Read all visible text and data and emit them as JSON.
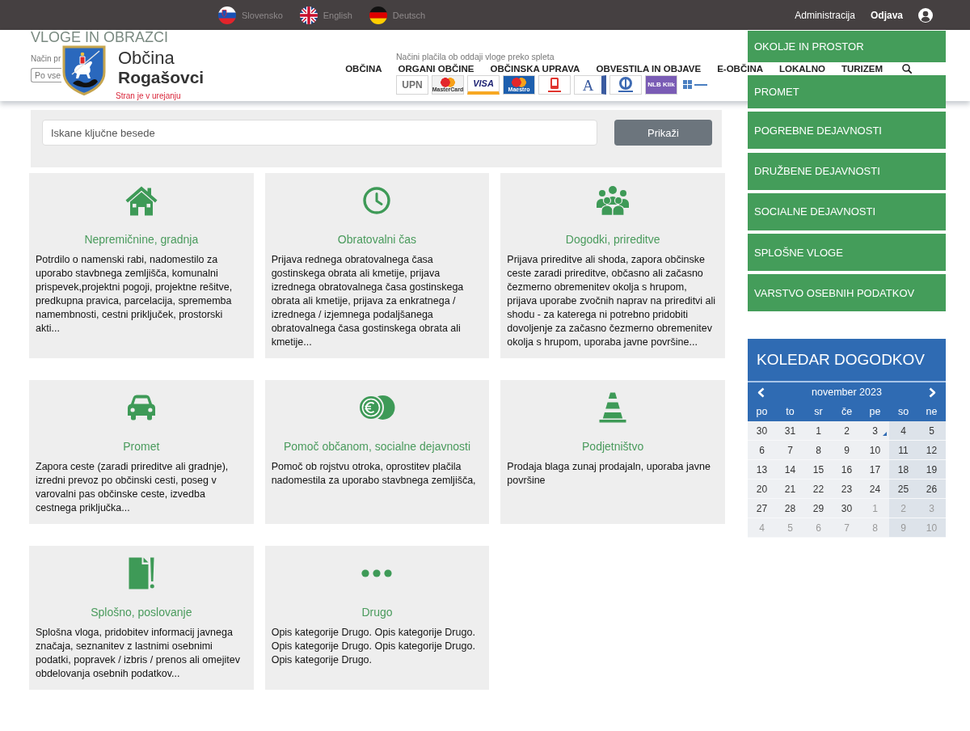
{
  "top_bar": {
    "languages": [
      {
        "kind": "si",
        "label": "Slovensko"
      },
      {
        "kind": "gb",
        "label": "English"
      },
      {
        "kind": "de",
        "label": "Deutsch"
      }
    ],
    "links": [
      {
        "label": "Administracija",
        "strong": false
      },
      {
        "label": "Odjava",
        "strong": true
      }
    ]
  },
  "header": {
    "name_line_1": "Občina",
    "name_line_2": "Rogašovci",
    "notice": "Stran je v urejanju",
    "nav": [
      "OBČINA",
      "ORGANI OBČINE",
      "OBČINSKA UPRAVA",
      "OBVESTILA IN OBJAVE",
      "E-OBČINA",
      "LOKALNO",
      "TURIZEM"
    ]
  },
  "forms": {
    "title": "VLOGE IN OBRAZCI",
    "filter": {
      "label": "Način pr",
      "value": "Po vse"
    },
    "payment_label": "Načini plačila ob oddaji vloge preko spleta",
    "payment_logos": [
      {
        "kind": "text",
        "label": "UPN",
        "color": "#ffffff"
      },
      {
        "kind": "circles",
        "label": "MasterCard",
        "color": "#f2f2f2"
      },
      {
        "kind": "stripe",
        "label": "VISA",
        "color": "#ffffff"
      },
      {
        "kind": "circles",
        "label": "Maestro",
        "color": "#1d5fae"
      },
      {
        "kind": "phone",
        "color": "#e0352f"
      },
      {
        "kind": "letter",
        "label": "A",
        "color": "#ffffff"
      },
      {
        "kind": "ring",
        "color": "#3d6ab3"
      },
      {
        "kind": "text",
        "label": "NLB Klik",
        "color": "#7a5cb5"
      },
      {
        "kind": "squares",
        "color": "#4a7fc1"
      }
    ]
  },
  "search": {
    "placeholder": "Iskane ključne besede",
    "button": "Prikaži"
  },
  "categories": [
    {
      "kind": "house",
      "title": "Nepremičnine, gradnja",
      "text": "Potrdilo o namenski rabi, nadomestilo za uporabo stavbnega zemljišča, komunalni prispevek,projektni pogoji, projektne rešitve, predkupna pravica, parcelacija, sprememba namembnosti, cestni priključek, prostorski akti..."
    },
    {
      "kind": "clock",
      "title": "Obratovalni čas",
      "text": "Prijava rednega obratovalnega časa gostinskega obrata ali kmetije, prijava izrednega obratovalnega časa gostinskega obrata ali kmetije, prijava za enkratnega / izrednega / izjemnega podaljšanega obratovalnega časa gostinskega obrata ali kmetije..."
    },
    {
      "kind": "people",
      "title": "Dogodki, prireditve",
      "text": "Prijava prireditve ali shoda, zapora občinske ceste zaradi prireditve, občasno ali začasno čezmerno obremenitev okolja s hrupom, prijava uporabe zvočnih naprav na prireditvi ali shodu - za katerega ni potrebno pridobiti dovoljenje za začasno čezmerno obremenitev okolja s hrupom, uporaba javne površine..."
    },
    {
      "kind": "car",
      "title": "Promet",
      "text": "Zapora ceste (zaradi prireditve ali gradnje), izredni prevoz po občinski cesti, poseg v varovalni pas občinske ceste, izvedba cestnega priključka..."
    },
    {
      "kind": "coins",
      "title": "Pomoč občanom, socialne dejavnosti",
      "text": "Pomoč ob rojstvu otroka, oprostitev plačila nadomestila za uporabo stavbnega zemljišča,"
    },
    {
      "kind": "cone",
      "title": "Podjetništvo",
      "text": "Prodaja blaga zunaj prodajaln, uporaba javne površine"
    },
    {
      "kind": "document",
      "title": "Splošno, poslovanje",
      "text": "Splošna vloga, pridobitev informacij javnega značaja, seznanitev z lastnimi osebnimi podatki, popravek / izbris / prenos ali omejitev obdelovanja osebnih podatkov..."
    },
    {
      "kind": "dots",
      "title": "Drugo",
      "text": "Opis kategorije Drugo. Opis kategorije Drugo. Opis kategorije Drugo. Opis kategorije Drugo. Opis kategorije Drugo."
    }
  ],
  "sidebar": {
    "items": [
      {
        "label": "OKOLJE IN PROSTOR"
      },
      {
        "label": "PROMET"
      },
      {
        "label": "POGREBNE DEJAVNOSTI"
      },
      {
        "label": "DRUŽBENE DEJAVNOSTI"
      },
      {
        "label": "SOCIALNE DEJAVNOSTI"
      },
      {
        "label": "SPLOŠNE VLOGE"
      },
      {
        "label": "VARSTVO OSEBNIH PODATKOV"
      }
    ]
  },
  "calendar": {
    "title": "KOLEDAR DOGODKOV",
    "month": "november 2023",
    "weekdays": [
      "po",
      "to",
      "sr",
      "če",
      "pe",
      "so",
      "ne"
    ],
    "weeks": [
      [
        {
          "day": "30",
          "muted": false,
          "event": false
        },
        {
          "day": "31",
          "muted": false,
          "event": false
        },
        {
          "day": "1",
          "muted": false,
          "event": false
        },
        {
          "day": "2",
          "muted": false,
          "event": false
        },
        {
          "day": "3",
          "muted": false,
          "event": true
        },
        {
          "day": "4",
          "muted": false,
          "event": false
        },
        {
          "day": "5",
          "muted": false,
          "event": false
        }
      ],
      [
        {
          "day": "6",
          "muted": false,
          "event": false
        },
        {
          "day": "7",
          "muted": false,
          "event": false
        },
        {
          "day": "8",
          "muted": false,
          "event": false
        },
        {
          "day": "9",
          "muted": false,
          "event": false
        },
        {
          "day": "10",
          "muted": false,
          "event": false
        },
        {
          "day": "11",
          "muted": false,
          "event": false
        },
        {
          "day": "12",
          "muted": false,
          "event": false
        }
      ],
      [
        {
          "day": "13",
          "muted": false,
          "event": false
        },
        {
          "day": "14",
          "muted": false,
          "event": false
        },
        {
          "day": "15",
          "muted": false,
          "event": false
        },
        {
          "day": "16",
          "muted": false,
          "event": false
        },
        {
          "day": "17",
          "muted": false,
          "event": false
        },
        {
          "day": "18",
          "muted": false,
          "event": false
        },
        {
          "day": "19",
          "muted": false,
          "event": false
        }
      ],
      [
        {
          "day": "20",
          "muted": false,
          "event": false
        },
        {
          "day": "21",
          "muted": false,
          "event": false
        },
        {
          "day": "22",
          "muted": false,
          "event": false
        },
        {
          "day": "23",
          "muted": false,
          "event": false
        },
        {
          "day": "24",
          "muted": false,
          "event": false
        },
        {
          "day": "25",
          "muted": false,
          "event": false
        },
        {
          "day": "26",
          "muted": false,
          "event": false
        }
      ],
      [
        {
          "day": "27",
          "muted": false,
          "event": false
        },
        {
          "day": "28",
          "muted": false,
          "event": false
        },
        {
          "day": "29",
          "muted": false,
          "event": false
        },
        {
          "day": "30",
          "muted": false,
          "event": false
        },
        {
          "day": "1",
          "muted": true,
          "event": false
        },
        {
          "day": "2",
          "muted": true,
          "event": false
        },
        {
          "day": "3",
          "muted": true,
          "event": false
        }
      ],
      [
        {
          "day": "4",
          "muted": true,
          "event": false
        },
        {
          "day": "5",
          "muted": true,
          "event": false
        },
        {
          "day": "6",
          "muted": true,
          "event": false
        },
        {
          "day": "7",
          "muted": true,
          "event": false
        },
        {
          "day": "8",
          "muted": true,
          "event": false
        },
        {
          "day": "9",
          "muted": true,
          "event": false
        },
        {
          "day": "10",
          "muted": true,
          "event": false
        }
      ]
    ]
  }
}
